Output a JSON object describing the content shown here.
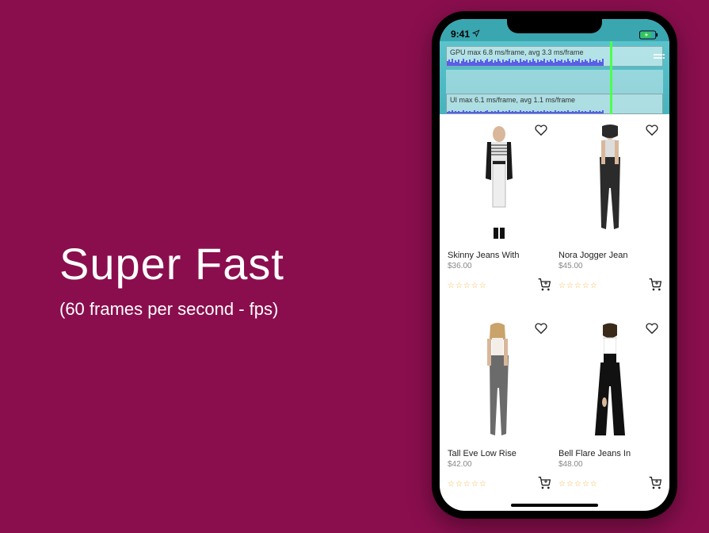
{
  "marketing": {
    "title": "Super Fast",
    "subtitle": "(60 frames per second - fps)"
  },
  "status": {
    "time": "9:41",
    "location_icon": "location-arrow",
    "battery_icon": "battery-charging"
  },
  "perf_overlay": {
    "gpu_label": "GPU  max 6.8 ms/frame, avg 3.3 ms/frame",
    "ui_label": "UI  max 6.1 ms/frame, avg 1.1 ms/frame"
  },
  "products": [
    {
      "title": "Skinny Jeans With",
      "price": "$36.00",
      "rating_icon": "stars-0",
      "fav_icon": "heart-outline",
      "cart_icon": "add-to-cart",
      "figure": "striped-top-dark-jacket"
    },
    {
      "title": "Nora Jogger Jean",
      "price": "$45.00",
      "rating_icon": "stars-0",
      "fav_icon": "heart-outline",
      "cart_icon": "add-to-cart",
      "figure": "dark-jogger"
    },
    {
      "title": "Tall Eve Low Rise",
      "price": "$42.00",
      "rating_icon": "stars-0",
      "fav_icon": "heart-outline",
      "cart_icon": "add-to-cart",
      "figure": "grey-skinny"
    },
    {
      "title": "Bell Flare Jeans In",
      "price": "$48.00",
      "rating_icon": "stars-0",
      "fav_icon": "heart-outline",
      "cart_icon": "add-to-cart",
      "figure": "black-flare"
    }
  ],
  "colors": {
    "bg": "#8a0e4e",
    "teal": "#3aa6b0",
    "star": "#f6b94a"
  }
}
